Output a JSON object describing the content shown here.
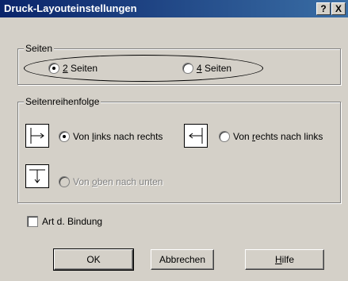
{
  "window": {
    "title": "Druck-Layouteinstellungen",
    "help_label": "?",
    "close_label": "X"
  },
  "seiten": {
    "legend": "Seiten",
    "option_2": {
      "prefix": "",
      "accel": "2",
      "rest": " Seiten",
      "checked": true
    },
    "option_4": {
      "prefix": "",
      "accel": "4",
      "rest": " Seiten",
      "checked": false
    }
  },
  "reihenfolge": {
    "legend": "Seitenreihenfolge",
    "ltr": {
      "prefix": "Von ",
      "accel": "l",
      "rest": "inks nach rechts",
      "checked": true,
      "icon": "arrow-right-icon"
    },
    "rtl": {
      "prefix": "Von ",
      "accel": "r",
      "rest": "echts nach links",
      "checked": false,
      "icon": "arrow-left-icon"
    },
    "ttb": {
      "prefix": "Von ",
      "accel": "o",
      "rest": "ben nach unten",
      "checked": false,
      "disabled": true,
      "icon": "arrow-down-icon"
    }
  },
  "bindung": {
    "label": "Art d. Bindung",
    "checked": false
  },
  "buttons": {
    "ok": "OK",
    "abbrechen": "Abbrechen",
    "hilfe": {
      "accel": "H",
      "rest": "ilfe"
    }
  }
}
